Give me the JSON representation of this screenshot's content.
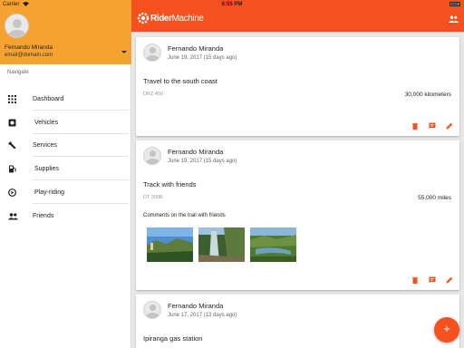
{
  "status_bar": {
    "carrier": "Carrier",
    "time": "6:55 PM"
  },
  "sidebar": {
    "user_name": "Fernando Miranda",
    "user_email": "email@domain.com",
    "nav_title": "Navigate",
    "items": [
      {
        "label": "Dashboard",
        "icon": "grid-icon"
      },
      {
        "label": "Vehicles",
        "icon": "engine-icon"
      },
      {
        "label": "Services",
        "icon": "wrench-icon"
      },
      {
        "label": "Supplies",
        "icon": "fuel-pump-icon"
      },
      {
        "label": "Play-riding",
        "icon": "play-circle-icon"
      },
      {
        "label": "Friends",
        "icon": "people-icon"
      }
    ]
  },
  "appbar": {
    "brand_left": "Rider",
    "brand_right": "Machine",
    "action_icon": "people-icon"
  },
  "feed": [
    {
      "author": "Fernando Miranda",
      "date": "June 19, 2017 (15 days ago)",
      "title": "Travel to the south coast",
      "bike": "DRZ 450",
      "distance": "30,000 kilometers"
    },
    {
      "author": "Fernando Miranda",
      "date": "June 19, 2017 (15 days ago)",
      "title": "Track with friends",
      "bike": "DT 200R",
      "distance": "55,000 miles",
      "comment": "Comments on the trail with friends"
    },
    {
      "author": "Fernando Miranda",
      "date": "June 17, 2017 (13 days ago)",
      "title": "Ipiranga gas station"
    }
  ],
  "colors": {
    "accent": "#f4511e",
    "sidebar_header": "#f5a230",
    "background": "#e7e7e7"
  },
  "fab": {
    "label": "+"
  }
}
